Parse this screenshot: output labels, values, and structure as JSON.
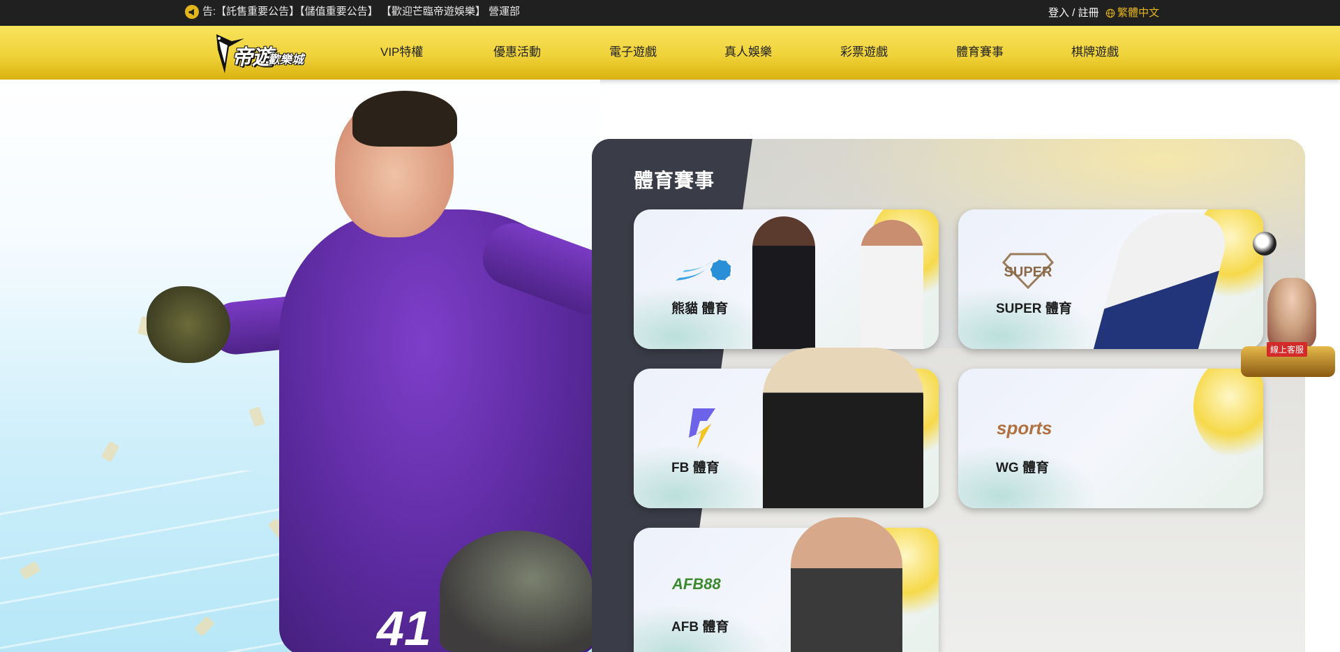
{
  "topbar": {
    "announcement": "告:【託售重要公告】【儲值重要公告】 【歡迎芒臨帝遊娛樂】 營運部",
    "login": "登入 / 註冊",
    "language": "繁體中文"
  },
  "logo": {
    "main": "帝遊",
    "sub": "歡樂城"
  },
  "nav": {
    "items": [
      "VIP特權",
      "優惠活動",
      "電子遊戲",
      "真人娛樂",
      "彩票遊戲",
      "體育賽事",
      "棋牌遊戲"
    ]
  },
  "hero": {
    "jersey_number": "41"
  },
  "sports": {
    "title": "體育賽事",
    "cards": [
      {
        "label": "熊貓 體育",
        "logo": "panda-wave-logo"
      },
      {
        "label": "SUPER 體育",
        "logo": "SUPER"
      },
      {
        "label": "FB 體育",
        "logo": "fb-bolt-logo"
      },
      {
        "label": "WG 體育",
        "logo": "sports"
      },
      {
        "label": "AFB 體育",
        "logo": "AFB88"
      }
    ]
  },
  "customer_service": {
    "label": "線上客服"
  },
  "colors": {
    "accent": "#e3b51c",
    "nav_yellow": "#f0d33a",
    "panel_dark": "#3a3c47"
  }
}
